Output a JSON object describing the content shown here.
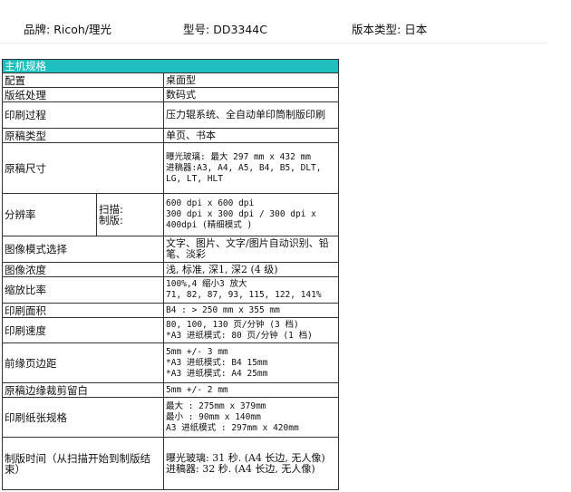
{
  "header": {
    "brand_label": "品牌:",
    "brand_value": "Ricoh/理光",
    "model_label": "型号:",
    "model_value": "DD3344C",
    "version_label": "版本类型:",
    "version_value": "日本"
  },
  "spec_table": {
    "title": "主机规格",
    "rows": {
      "config": {
        "key": "配置",
        "value": "桌面型"
      },
      "master": {
        "key": "版纸处理",
        "value": "数码式"
      },
      "process": {
        "key": "印刷过程",
        "value": "压力辊系统、全自动单印筒制版印刷"
      },
      "original_type": {
        "key": "原稿类型",
        "value": "单页、书本"
      },
      "original_size": {
        "key": "原稿尺寸",
        "line1": "曝光玻璃: 最大 297 mm x 432 mm",
        "line2": "进稿器:A3, A4, A5, B4, B5, DLT, LG, LT, HLT"
      },
      "resolution": {
        "key": "分辨率",
        "sub_scan": "扫描:",
        "sub_make": "制版:",
        "line1": "600 dpi x 600 dpi",
        "line2": "300 dpi x 300 dpi / 300 dpi x 400dpi (精细模式 )"
      },
      "image_mode": {
        "key": "图像模式选择",
        "value": "文字、图片、文字/图片自动识别、铅笔、淡彩"
      },
      "density": {
        "key": "图像浓度",
        "value": "浅, 标准, 深1, 深2 (4 级)"
      },
      "zoom": {
        "key": "缩放比率",
        "line1": "100%,4 缩小3 放大",
        "line2": "71, 82, 87, 93, 115, 122, 141%"
      },
      "print_area": {
        "key": "印刷面积",
        "value": "B4 : > 250 mm x 355 mm"
      },
      "speed": {
        "key": "印刷速度",
        "line1": "80, 100, 130 页/分钟 (3 档)",
        "line2": "*A3 进纸模式: 80 页/分钟 (1 档)"
      },
      "lead_margin": {
        "key": "前缘页边距",
        "line1": "5mm +/- 3 mm",
        "line2": "*A3 进纸模式: B4 15mm",
        "line3": "*A3 进纸模式: A4 25mm"
      },
      "edge_margin": {
        "key": "原稿边缘裁剪留白",
        "value": "5mm +/- 2 mm"
      },
      "paper_size": {
        "key": "印刷纸张规格",
        "line1": "最大 : 275mm x 379mm",
        "line2": "最小 : 90mm x 140mm",
        "line3": "A3 进纸模式 : 297mm x 420mm"
      },
      "make_time": {
        "key": "制版时间（从扫描开始到制版结束）",
        "line1": "曝光玻璃: 31 秒. (A4 长边, 无人像)",
        "line2": "进稿器:    32 秒. (A4 长边, 无人像)"
      }
    }
  },
  "colors": {
    "header_fill": "#1fbfbf",
    "header_text": "#ffffff",
    "border": "#333333"
  }
}
